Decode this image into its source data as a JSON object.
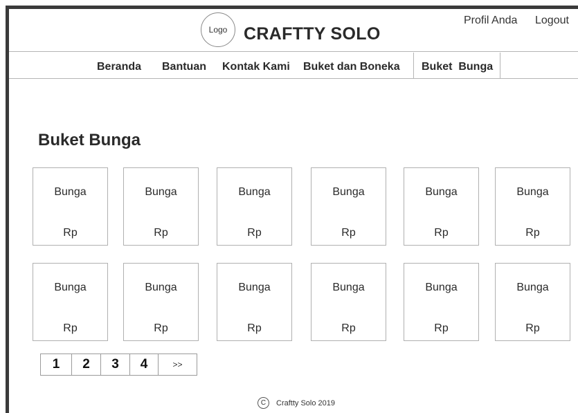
{
  "header": {
    "logo_text": "Logo",
    "title": "CRAFTTY SOLO",
    "profile_link": "Profil Anda",
    "logout_link": "Logout"
  },
  "nav": {
    "items": [
      {
        "label": "Beranda"
      },
      {
        "label": "Bantuan"
      },
      {
        "label": "Kontak Kami"
      },
      {
        "label": "Buket dan Boneka"
      },
      {
        "label": "Buket  Bunga"
      }
    ]
  },
  "main": {
    "section_title": "Buket Bunga",
    "products": [
      {
        "name": "Bunga",
        "price": "Rp"
      },
      {
        "name": "Bunga",
        "price": "Rp"
      },
      {
        "name": "Bunga",
        "price": "Rp"
      },
      {
        "name": "Bunga",
        "price": "Rp"
      },
      {
        "name": "Bunga",
        "price": "Rp"
      },
      {
        "name": "Bunga",
        "price": "Rp"
      },
      {
        "name": "Bunga",
        "price": "Rp"
      },
      {
        "name": "Bunga",
        "price": "Rp"
      },
      {
        "name": "Bunga",
        "price": "Rp"
      },
      {
        "name": "Bunga",
        "price": "Rp"
      },
      {
        "name": "Bunga",
        "price": "Rp"
      },
      {
        "name": "Bunga",
        "price": "Rp"
      }
    ]
  },
  "pagination": {
    "pages": [
      "1",
      "2",
      "3",
      "4"
    ],
    "next_label": ">>"
  },
  "footer": {
    "copyright_symbol": "C",
    "text": "Craftty Solo 2019"
  }
}
